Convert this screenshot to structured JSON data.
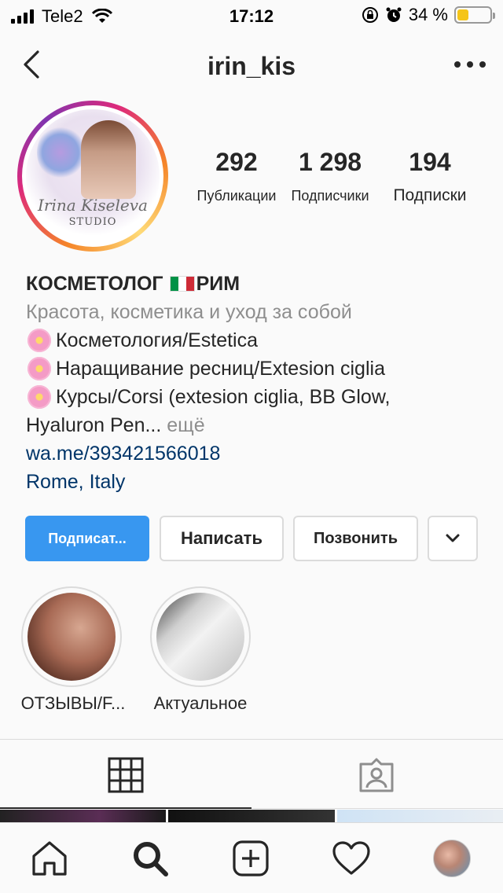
{
  "status_bar": {
    "carrier": "Tele2",
    "time": "17:12",
    "battery_percent": "34 %",
    "battery_level": 0.34,
    "battery_color": "#f5c518"
  },
  "header": {
    "username": "irin_kis",
    "back_icon": "chevron-left-icon",
    "more_icon": "more-horizontal-icon"
  },
  "avatar": {
    "brand": "Irina Kiseleva",
    "brand_sub": "STUDIO"
  },
  "stats": [
    {
      "value": "292",
      "label": "Публикации"
    },
    {
      "value": "1 298",
      "label": "Подписчики"
    },
    {
      "value": "194",
      "label": "Подписки"
    }
  ],
  "bio": {
    "name": "КОСМЕТОЛОГ",
    "name_suffix": "РИМ",
    "category": "Красота, косметика и уход за собой",
    "lines": [
      "Косметология/Estetica",
      "Наращивание ресниц/Extesion ciglia",
      "Курсы/Corsi (extesion ciglia, BB Glow,"
    ],
    "truncated_line": "Hyaluron Pen...",
    "more_label": "ещё",
    "website": "wa.me/393421566018",
    "location": "Rome, Italy"
  },
  "actions": {
    "follow_label": "Подписат...",
    "message_label": "Написать",
    "call_label": "Позвонить",
    "follow_color": "#3897f0"
  },
  "highlights": [
    {
      "label": "ОТЗЫВЫ/F..."
    },
    {
      "label": "Актуальное"
    }
  ],
  "tabs": {
    "grid_icon": "grid-icon",
    "tagged_icon": "tagged-person-icon"
  },
  "bottom_nav": {
    "home_icon": "home-icon",
    "search_icon": "search-icon",
    "add_icon": "add-post-icon",
    "activity_icon": "heart-icon",
    "profile_icon": "profile-avatar-icon"
  }
}
